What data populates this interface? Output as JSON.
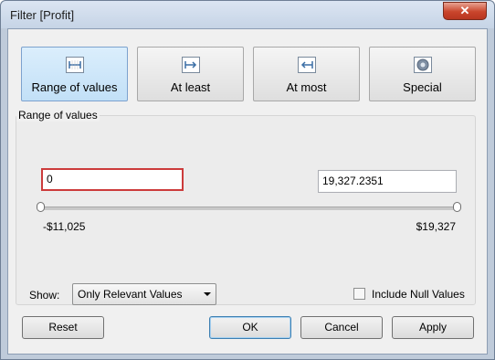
{
  "window": {
    "title": "Filter [Profit]",
    "close_label": "✕"
  },
  "tabs": [
    {
      "label": "Range of values",
      "icon": "range-icon",
      "active": true
    },
    {
      "label": "At least",
      "icon": "at-least-icon",
      "active": false
    },
    {
      "label": "At most",
      "icon": "at-most-icon",
      "active": false
    },
    {
      "label": "Special",
      "icon": "special-icon",
      "active": false
    }
  ],
  "range_panel": {
    "group_label": "Range of values",
    "min_value": "0",
    "max_value": "19,327.2351",
    "slider_min_label": "-$11,025",
    "slider_max_label": "$19,327",
    "slider_min_fraction": 0.0,
    "slider_max_fraction": 1.0
  },
  "options": {
    "show_label": "Show:",
    "show_value": "Only Relevant Values",
    "include_null_label": "Include Null Values",
    "include_null_checked": false
  },
  "buttons": {
    "reset": "Reset",
    "ok": "OK",
    "cancel": "Cancel",
    "apply": "Apply"
  },
  "colors": {
    "active_tab": "#c2e0f7",
    "focus_border": "#cc3b3b",
    "close_button": "#c9452c"
  }
}
